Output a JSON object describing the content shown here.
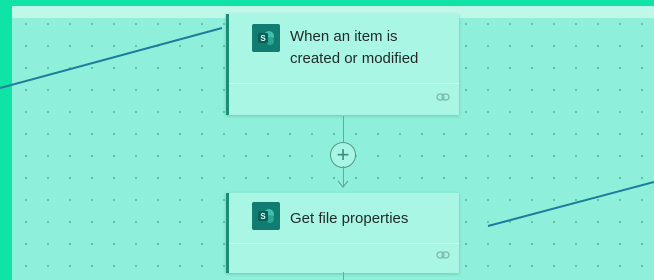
{
  "flow": {
    "trigger": {
      "title": "When an item is created or modified",
      "connector_icon": "sharepoint-icon",
      "footer_icon": "link-icon"
    },
    "actions": [
      {
        "title": "Get file properties",
        "connector_icon": "sharepoint-icon",
        "footer_icon": "link-icon"
      }
    ],
    "add_step_icon": "plus-icon"
  },
  "colors": {
    "canvas": "#8ef0da",
    "card": "#a9f6e5",
    "card_accent": "#1b8f76",
    "sharepoint_tile": "#117c72",
    "pointer_line": "#1d7d9a",
    "rail": "#10e3a6"
  }
}
